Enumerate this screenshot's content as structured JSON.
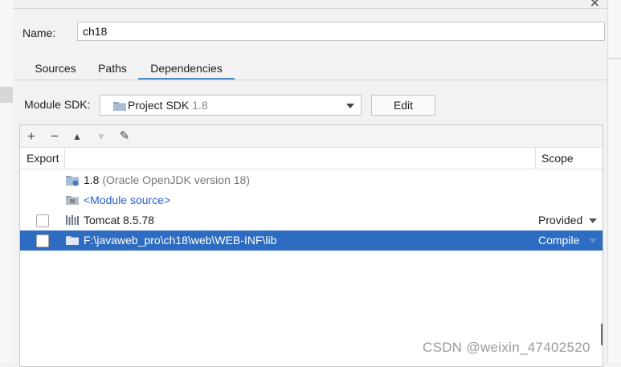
{
  "dialog": {
    "name_label": "Name:",
    "name_value": "ch18"
  },
  "tabs": [
    {
      "label": "Sources",
      "active": false
    },
    {
      "label": "Paths",
      "active": false
    },
    {
      "label": "Dependencies",
      "active": true
    }
  ],
  "module_sdk": {
    "label": "Module SDK:",
    "selected": "Project SDK",
    "version": "1.8",
    "edit_label": "Edit"
  },
  "toolbar": {
    "add": "+",
    "remove": "−",
    "move_up": "▲",
    "move_down": "▼",
    "edit": "✎"
  },
  "table": {
    "headers": {
      "export": "Export",
      "scope": "Scope"
    },
    "rows": [
      {
        "name": "1.8",
        "detail": "(Oracle OpenJDK version 18)",
        "icon": "jdk-icon",
        "has_checkbox": false,
        "scope": ""
      },
      {
        "name": "<Module source>",
        "detail": "",
        "icon": "module-source-folder-icon",
        "has_checkbox": false,
        "scope": ""
      },
      {
        "name": "Tomcat 8.5.78",
        "detail": "",
        "icon": "library-icon",
        "has_checkbox": true,
        "scope": "Provided"
      },
      {
        "name": "F:\\javaweb_pro\\ch18\\web\\WEB-INF\\lib",
        "detail": "",
        "icon": "folder-icon",
        "has_checkbox": true,
        "scope": "Compile",
        "selected": true
      }
    ]
  },
  "watermark": "CSDN @weixin_47402520",
  "colors": {
    "selection": "#2d6cc0",
    "tab_underline": "#4a86c8",
    "link": "#2a5cd0"
  }
}
